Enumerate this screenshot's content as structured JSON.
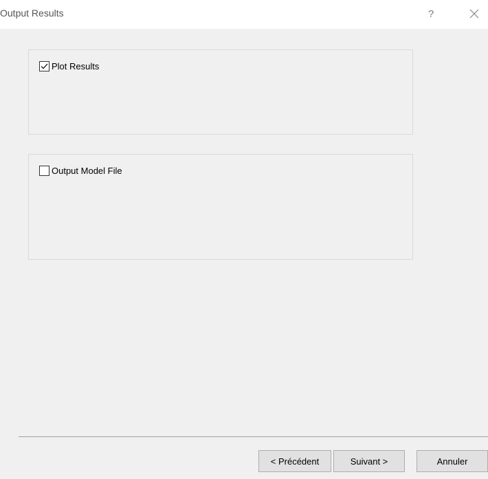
{
  "window": {
    "title": "Output Results",
    "help_label": "?"
  },
  "groups": [
    {
      "checkbox_label": "Plot Results",
      "checked": true
    },
    {
      "checkbox_label": "Output Model File",
      "checked": false
    }
  ],
  "footer": {
    "back_label": "< Précédent",
    "next_label": "Suivant >",
    "cancel_label": "Annuler"
  },
  "icons": {
    "close": "close-icon",
    "check": "checkmark-icon"
  }
}
